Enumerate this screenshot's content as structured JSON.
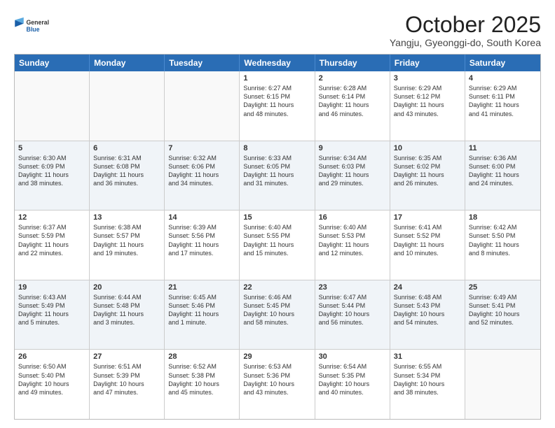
{
  "logo": {
    "general": "General",
    "blue": "Blue"
  },
  "title": "October 2025",
  "subtitle": "Yangju, Gyeonggi-do, South Korea",
  "header_days": [
    "Sunday",
    "Monday",
    "Tuesday",
    "Wednesday",
    "Thursday",
    "Friday",
    "Saturday"
  ],
  "weeks": [
    [
      {
        "day": "",
        "lines": []
      },
      {
        "day": "",
        "lines": []
      },
      {
        "day": "",
        "lines": []
      },
      {
        "day": "1",
        "lines": [
          "Sunrise: 6:27 AM",
          "Sunset: 6:15 PM",
          "Daylight: 11 hours",
          "and 48 minutes."
        ]
      },
      {
        "day": "2",
        "lines": [
          "Sunrise: 6:28 AM",
          "Sunset: 6:14 PM",
          "Daylight: 11 hours",
          "and 46 minutes."
        ]
      },
      {
        "day": "3",
        "lines": [
          "Sunrise: 6:29 AM",
          "Sunset: 6:12 PM",
          "Daylight: 11 hours",
          "and 43 minutes."
        ]
      },
      {
        "day": "4",
        "lines": [
          "Sunrise: 6:29 AM",
          "Sunset: 6:11 PM",
          "Daylight: 11 hours",
          "and 41 minutes."
        ]
      }
    ],
    [
      {
        "day": "5",
        "lines": [
          "Sunrise: 6:30 AM",
          "Sunset: 6:09 PM",
          "Daylight: 11 hours",
          "and 38 minutes."
        ]
      },
      {
        "day": "6",
        "lines": [
          "Sunrise: 6:31 AM",
          "Sunset: 6:08 PM",
          "Daylight: 11 hours",
          "and 36 minutes."
        ]
      },
      {
        "day": "7",
        "lines": [
          "Sunrise: 6:32 AM",
          "Sunset: 6:06 PM",
          "Daylight: 11 hours",
          "and 34 minutes."
        ]
      },
      {
        "day": "8",
        "lines": [
          "Sunrise: 6:33 AM",
          "Sunset: 6:05 PM",
          "Daylight: 11 hours",
          "and 31 minutes."
        ]
      },
      {
        "day": "9",
        "lines": [
          "Sunrise: 6:34 AM",
          "Sunset: 6:03 PM",
          "Daylight: 11 hours",
          "and 29 minutes."
        ]
      },
      {
        "day": "10",
        "lines": [
          "Sunrise: 6:35 AM",
          "Sunset: 6:02 PM",
          "Daylight: 11 hours",
          "and 26 minutes."
        ]
      },
      {
        "day": "11",
        "lines": [
          "Sunrise: 6:36 AM",
          "Sunset: 6:00 PM",
          "Daylight: 11 hours",
          "and 24 minutes."
        ]
      }
    ],
    [
      {
        "day": "12",
        "lines": [
          "Sunrise: 6:37 AM",
          "Sunset: 5:59 PM",
          "Daylight: 11 hours",
          "and 22 minutes."
        ]
      },
      {
        "day": "13",
        "lines": [
          "Sunrise: 6:38 AM",
          "Sunset: 5:57 PM",
          "Daylight: 11 hours",
          "and 19 minutes."
        ]
      },
      {
        "day": "14",
        "lines": [
          "Sunrise: 6:39 AM",
          "Sunset: 5:56 PM",
          "Daylight: 11 hours",
          "and 17 minutes."
        ]
      },
      {
        "day": "15",
        "lines": [
          "Sunrise: 6:40 AM",
          "Sunset: 5:55 PM",
          "Daylight: 11 hours",
          "and 15 minutes."
        ]
      },
      {
        "day": "16",
        "lines": [
          "Sunrise: 6:40 AM",
          "Sunset: 5:53 PM",
          "Daylight: 11 hours",
          "and 12 minutes."
        ]
      },
      {
        "day": "17",
        "lines": [
          "Sunrise: 6:41 AM",
          "Sunset: 5:52 PM",
          "Daylight: 11 hours",
          "and 10 minutes."
        ]
      },
      {
        "day": "18",
        "lines": [
          "Sunrise: 6:42 AM",
          "Sunset: 5:50 PM",
          "Daylight: 11 hours",
          "and 8 minutes."
        ]
      }
    ],
    [
      {
        "day": "19",
        "lines": [
          "Sunrise: 6:43 AM",
          "Sunset: 5:49 PM",
          "Daylight: 11 hours",
          "and 5 minutes."
        ]
      },
      {
        "day": "20",
        "lines": [
          "Sunrise: 6:44 AM",
          "Sunset: 5:48 PM",
          "Daylight: 11 hours",
          "and 3 minutes."
        ]
      },
      {
        "day": "21",
        "lines": [
          "Sunrise: 6:45 AM",
          "Sunset: 5:46 PM",
          "Daylight: 11 hours",
          "and 1 minute."
        ]
      },
      {
        "day": "22",
        "lines": [
          "Sunrise: 6:46 AM",
          "Sunset: 5:45 PM",
          "Daylight: 10 hours",
          "and 58 minutes."
        ]
      },
      {
        "day": "23",
        "lines": [
          "Sunrise: 6:47 AM",
          "Sunset: 5:44 PM",
          "Daylight: 10 hours",
          "and 56 minutes."
        ]
      },
      {
        "day": "24",
        "lines": [
          "Sunrise: 6:48 AM",
          "Sunset: 5:43 PM",
          "Daylight: 10 hours",
          "and 54 minutes."
        ]
      },
      {
        "day": "25",
        "lines": [
          "Sunrise: 6:49 AM",
          "Sunset: 5:41 PM",
          "Daylight: 10 hours",
          "and 52 minutes."
        ]
      }
    ],
    [
      {
        "day": "26",
        "lines": [
          "Sunrise: 6:50 AM",
          "Sunset: 5:40 PM",
          "Daylight: 10 hours",
          "and 49 minutes."
        ]
      },
      {
        "day": "27",
        "lines": [
          "Sunrise: 6:51 AM",
          "Sunset: 5:39 PM",
          "Daylight: 10 hours",
          "and 47 minutes."
        ]
      },
      {
        "day": "28",
        "lines": [
          "Sunrise: 6:52 AM",
          "Sunset: 5:38 PM",
          "Daylight: 10 hours",
          "and 45 minutes."
        ]
      },
      {
        "day": "29",
        "lines": [
          "Sunrise: 6:53 AM",
          "Sunset: 5:36 PM",
          "Daylight: 10 hours",
          "and 43 minutes."
        ]
      },
      {
        "day": "30",
        "lines": [
          "Sunrise: 6:54 AM",
          "Sunset: 5:35 PM",
          "Daylight: 10 hours",
          "and 40 minutes."
        ]
      },
      {
        "day": "31",
        "lines": [
          "Sunrise: 6:55 AM",
          "Sunset: 5:34 PM",
          "Daylight: 10 hours",
          "and 38 minutes."
        ]
      },
      {
        "day": "",
        "lines": []
      }
    ]
  ]
}
